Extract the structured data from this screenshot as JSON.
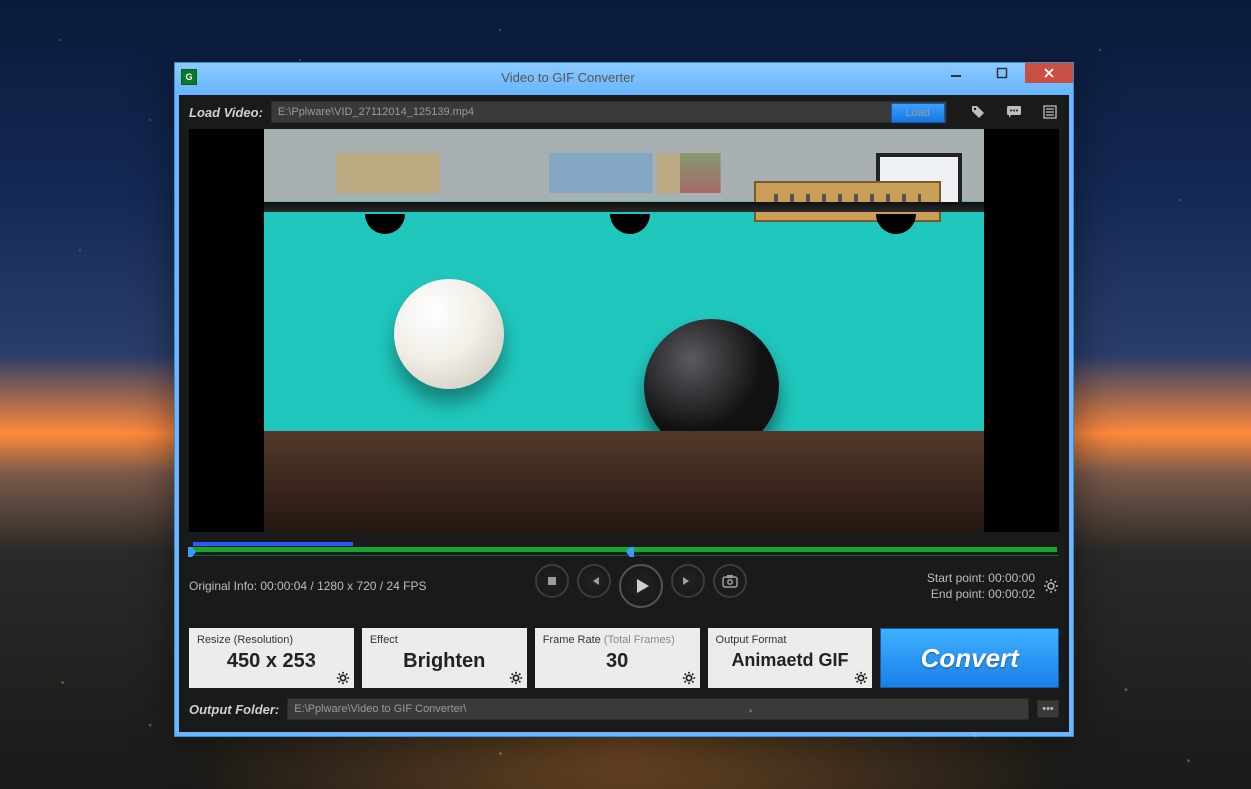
{
  "window": {
    "title": "Video to GIF Converter"
  },
  "toolbar": {
    "load_label": "Load Video:",
    "path": "E:\\Pplware\\VID_27112014_125139.mp4",
    "load_button": "Load"
  },
  "info": {
    "original": "Original Info: 00:00:04 / 1280 x 720 / 24 FPS",
    "start_label": "Start point:",
    "start_value": "00:00:00",
    "end_label": "End point:",
    "end_value": "00:00:02"
  },
  "cards": {
    "resize_head": "Resize (Resolution)",
    "resize_val": "450 x 253",
    "effect_head": "Effect",
    "effect_val": "Brighten",
    "fps_head": "Frame Rate ",
    "fps_head_muted": "(Total Frames)",
    "fps_val": "30",
    "format_head": "Output Format",
    "format_val": "Animaetd GIF"
  },
  "convert_label": "Convert",
  "output": {
    "label": "Output Folder:",
    "path": "E:\\Pplware\\Video to GIF Converter\\"
  }
}
